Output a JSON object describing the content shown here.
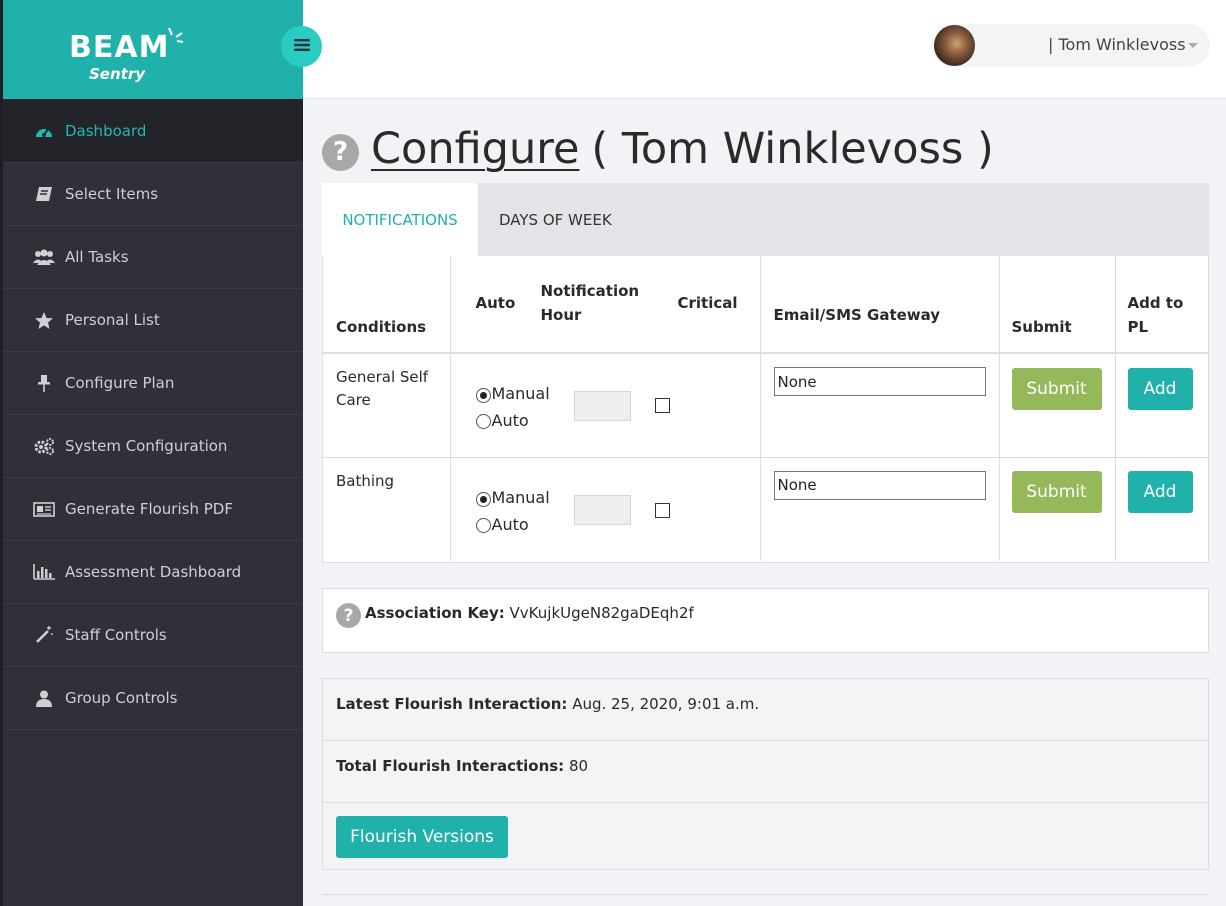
{
  "brand": {
    "name": "BEAM",
    "subtitle": "Sentry",
    "accent": "#20b2aa"
  },
  "header": {
    "user_name": "| Tom Winklevoss",
    "menu_icon": "hamburger-icon",
    "dropdown_icon": "caret-down-icon"
  },
  "sidebar": {
    "items": [
      {
        "label": "Dashboard",
        "icon": "dashboard-icon",
        "active": true
      },
      {
        "label": "Select Items",
        "icon": "book-icon"
      },
      {
        "label": "All Tasks",
        "icon": "users-icon"
      },
      {
        "label": "Personal List",
        "icon": "star-icon"
      },
      {
        "label": "Configure Plan",
        "icon": "pin-icon"
      },
      {
        "label": "System Configuration",
        "icon": "gears-icon"
      },
      {
        "label": "Generate Flourish PDF",
        "icon": "newspaper-icon"
      },
      {
        "label": "Assessment Dashboard",
        "icon": "bar-chart-icon"
      },
      {
        "label": "Staff Controls",
        "icon": "magic-wand-icon"
      },
      {
        "label": "Group Controls",
        "icon": "user-icon"
      }
    ]
  },
  "page": {
    "title_link": "Configure",
    "title_rest": "( Tom Winklevoss )"
  },
  "tabs": [
    {
      "label": "NOTIFICATIONS",
      "active": true
    },
    {
      "label": "DAYS OF WEEK",
      "active": false
    }
  ],
  "table": {
    "headers": {
      "conditions": "Conditions",
      "auto": "Auto",
      "notification_hour_1": "Notification",
      "notification_hour_2": "Hour",
      "critical": "Critical",
      "gateway": "Email/SMS Gateway",
      "submit": "Submit",
      "add_pl_1": "Add to",
      "add_pl_2": "PL"
    },
    "rows": [
      {
        "condition_1": "General Self",
        "condition_2": "Care",
        "mode_manual": "Manual",
        "mode_auto": "Auto",
        "selected": "Manual",
        "hour": "",
        "critical": false,
        "gateway": "None",
        "submit_label": "Submit",
        "add_label": "Add"
      },
      {
        "condition_1": "Bathing",
        "condition_2": "",
        "mode_manual": "Manual",
        "mode_auto": "Auto",
        "selected": "Manual",
        "hour": "",
        "critical": false,
        "gateway": "None",
        "submit_label": "Submit",
        "add_label": "Add"
      }
    ]
  },
  "association": {
    "label": "Association Key:",
    "value": "VvKujkUgeN82gaDEqh2f"
  },
  "flourish": {
    "latest_label": "Latest Flourish Interaction:",
    "latest_value": "Aug. 25, 2020, 9:01 a.m.",
    "total_label": "Total Flourish Interactions:",
    "total_value": "80",
    "versions_button": "Flourish Versions"
  },
  "colors": {
    "teal": "#20b2aa",
    "submit_green": "#94b85a",
    "sidebar_bg": "#2f3038"
  }
}
